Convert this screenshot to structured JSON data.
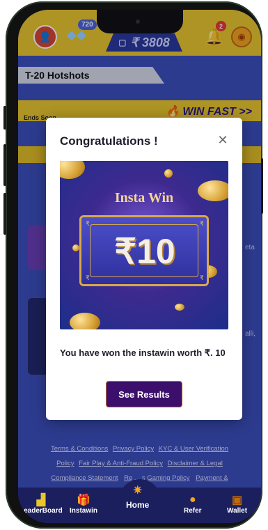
{
  "header": {
    "gem_count": "720",
    "balance": "₹ 3808",
    "notification_count": "2"
  },
  "contest": {
    "section_title": "T-20 Hotshots",
    "ends_label": "Ends Soon",
    "promo_label": "WIN FAST >>"
  },
  "modal": {
    "title": "Congratulations !",
    "close_icon": "close-icon",
    "prize_image": {
      "title": "Insta Win",
      "amount": "₹10"
    },
    "message": "You have won the instawin worth ₹. 10",
    "button_label": "See Results"
  },
  "background_fragments": {
    "right_text_1": "eta",
    "right_text_2": "alli,"
  },
  "footer": {
    "links_row1": [
      "Terms & Conditions",
      "Privacy Policy",
      "KYC & User Verification"
    ],
    "links_row2": [
      "Policy",
      "Fair Play & Anti-Fraud Policy",
      "Disclaimer & Legal"
    ],
    "links_row3": [
      "Compliance Statement",
      "Re",
      "s Gaming Policy",
      "Payment &"
    ]
  },
  "nav": {
    "items": [
      {
        "label": "LeaderBoard",
        "icon": "trophy-icon"
      },
      {
        "label": "Instawin",
        "icon": "gift-icon"
      },
      {
        "label": "Home",
        "icon": "home-icon"
      },
      {
        "label": "Refer",
        "icon": "coin-icon"
      },
      {
        "label": "Wallet",
        "icon": "wallet-icon"
      }
    ]
  },
  "colors": {
    "background": "#3d4fb8",
    "header_yellow": "#e9c62a",
    "button": "#3b0f6b",
    "navbar": "#1b1f5e"
  }
}
